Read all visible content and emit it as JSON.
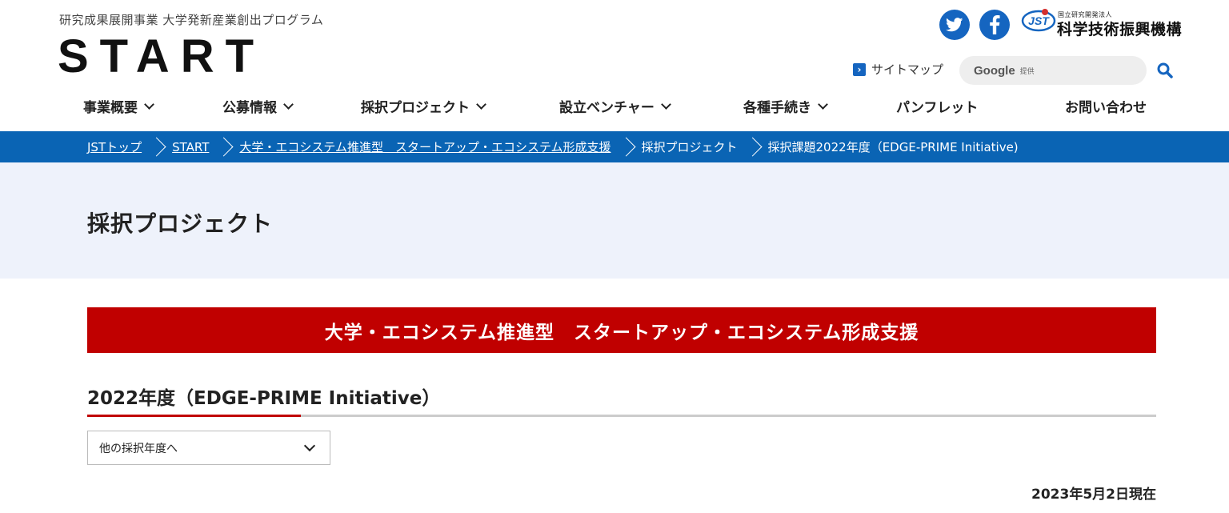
{
  "header": {
    "tagline": "研究成果展開事業 大学発新産業創出プログラム",
    "logo_text": "START",
    "social": {
      "twitter_icon": "twitter-bird",
      "facebook_icon": "facebook-f"
    },
    "org": {
      "mark_text": "JST",
      "small_label": "国立研究開発法人",
      "name": "科学技術振興機構"
    },
    "sitemap_label": "サイトマップ",
    "search": {
      "google_label": "Google",
      "provider_label": "提供",
      "button_icon": "search-magnifier"
    }
  },
  "global_nav": {
    "items": [
      {
        "label": "事業概要",
        "has_dropdown": true
      },
      {
        "label": "公募情報",
        "has_dropdown": true
      },
      {
        "label": "採択プロジェクト",
        "has_dropdown": true
      },
      {
        "label": "設立ベンチャー",
        "has_dropdown": true
      },
      {
        "label": "各種手続き",
        "has_dropdown": true
      },
      {
        "label": "パンフレット",
        "has_dropdown": false
      },
      {
        "label": "お問い合わせ",
        "has_dropdown": false
      }
    ]
  },
  "breadcrumb": {
    "items": [
      {
        "label": "JSTトップ",
        "link": true
      },
      {
        "label": "START",
        "link": true
      },
      {
        "label": "大学・エコシステム推進型　スタートアップ・エコシステム形成支援",
        "link": true
      },
      {
        "label": "採択プロジェクト",
        "link": false
      },
      {
        "label": "採択課題2022年度（EDGE-PRIME Initiative)",
        "link": false
      }
    ]
  },
  "page": {
    "title": "採択プロジェクト",
    "banner": "大学・エコシステム推進型　スタートアップ・エコシステム形成支援",
    "year_heading": "2022年度（EDGE-PRIME Initiative）",
    "year_select": {
      "value": "他の採択年度へ"
    },
    "date_note": "2023年5月2日現在"
  },
  "colors": {
    "brand_blue": "#0a64b4",
    "accent_red": "#c00000",
    "header_bg": "#eef2fb"
  }
}
